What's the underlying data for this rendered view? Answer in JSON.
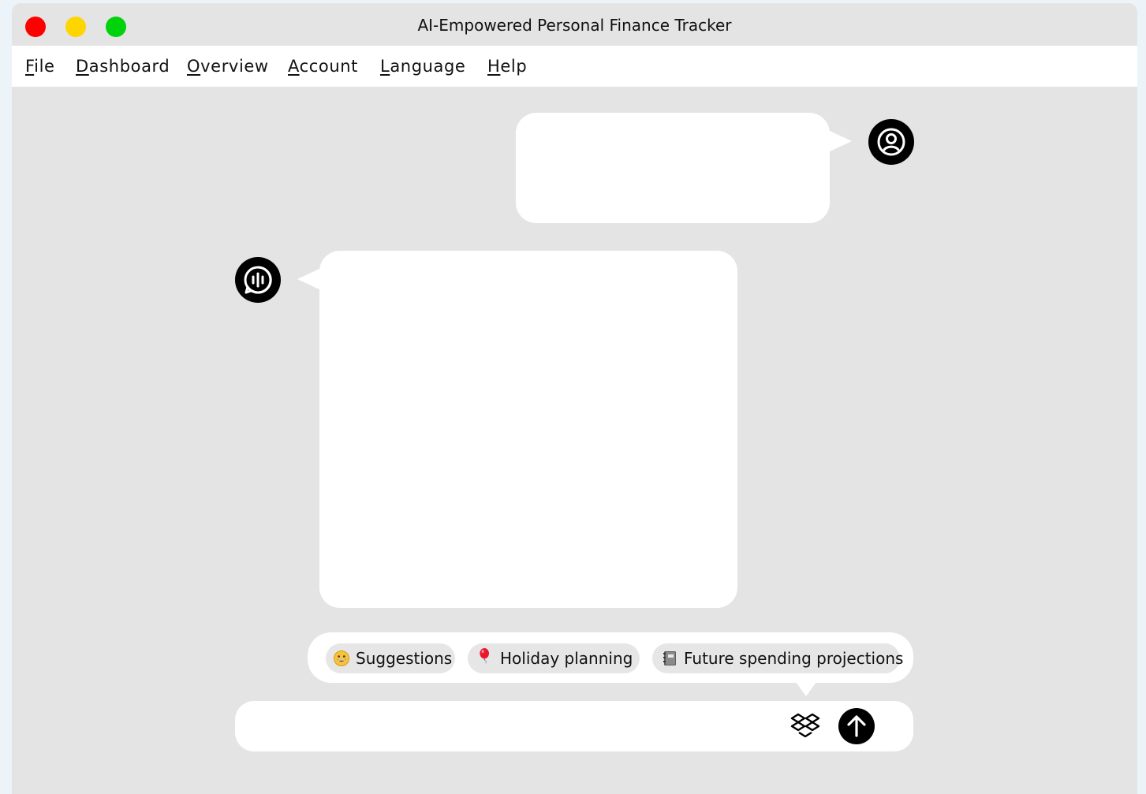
{
  "window": {
    "title": "AI-Empowered Personal Finance Tracker"
  },
  "menu": [
    {
      "mnemonic": "F",
      "rest": "ile"
    },
    {
      "mnemonic": "D",
      "rest": "ashboard"
    },
    {
      "mnemonic": "O",
      "rest": "verview"
    },
    {
      "mnemonic": "A",
      "rest": "ccount"
    },
    {
      "mnemonic": "L",
      "rest": "anguage"
    },
    {
      "mnemonic": "H",
      "rest": "elp"
    }
  ],
  "chat": {
    "user_message": "",
    "ai_message": ""
  },
  "suggestions": [
    {
      "icon": "grinning-face-icon",
      "label": "Suggestions"
    },
    {
      "icon": "balloon-icon",
      "label": "Holiday planning"
    },
    {
      "icon": "notebook-icon",
      "label": "Future spending projections"
    }
  ],
  "input": {
    "value": "",
    "placeholder": ""
  },
  "colors": {
    "close": "#fe0000",
    "minimize": "#ffd500",
    "maximize": "#00d20b",
    "window_bg": "#e4e4e4",
    "page_bg": "#ecf3f9"
  }
}
